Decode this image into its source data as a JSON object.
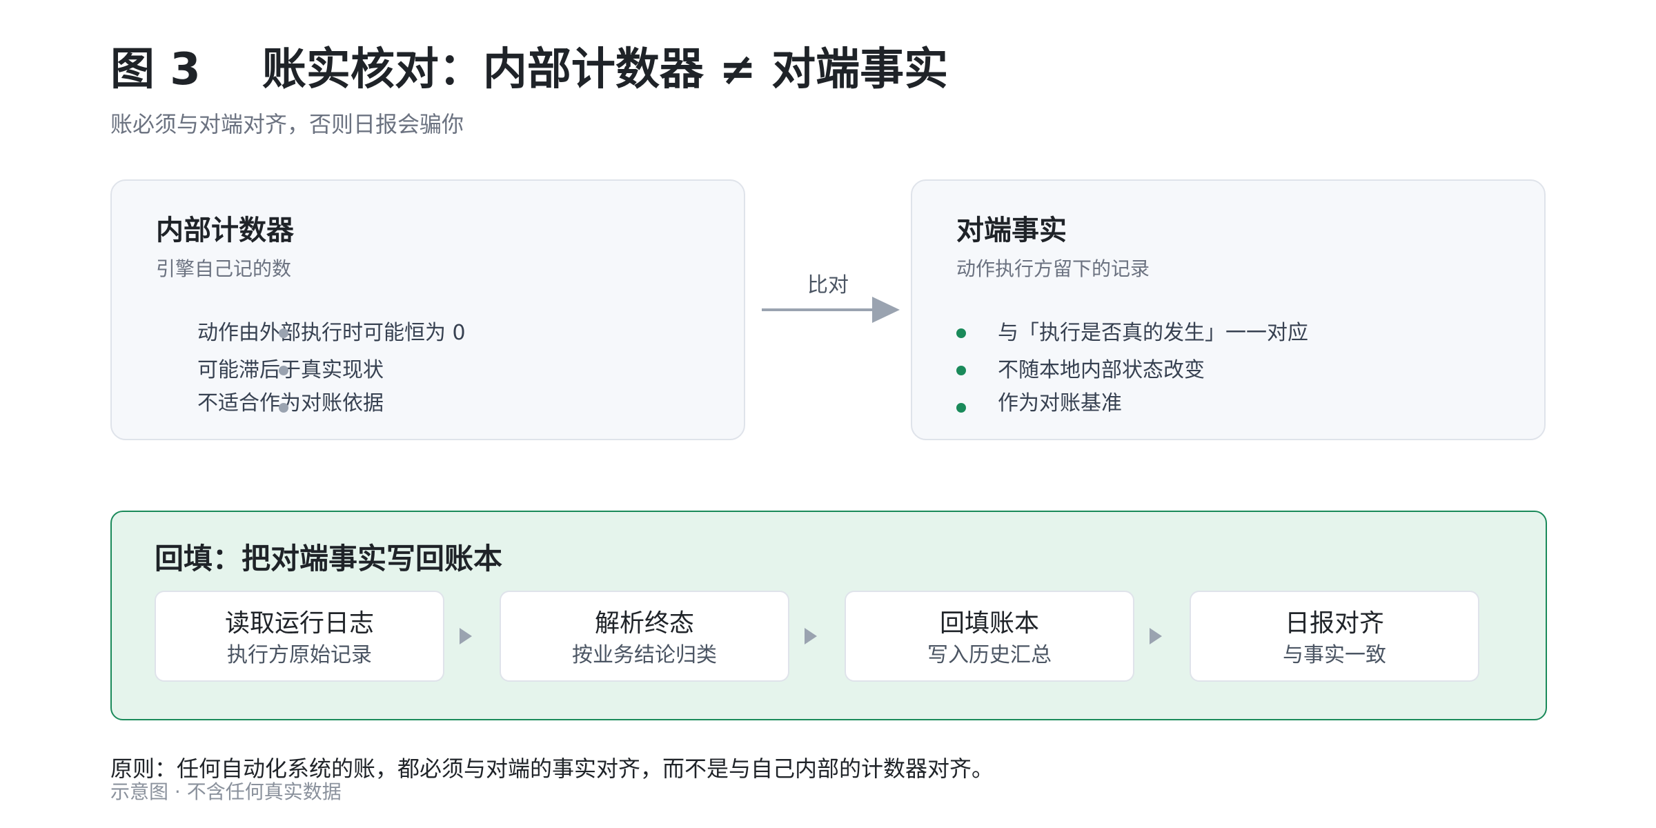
{
  "figure": {
    "title": "图 3    账实核对：内部计数器 ≠ 对端事实",
    "subtitle": "账必须与对端对齐，否则日报会骗你"
  },
  "internal_counter": {
    "title": "内部计数器",
    "subtitle": "引擎自己记的数",
    "bullets": [
      "动作由外部执行时可能恒为 0",
      "可能滞后于真实现状",
      "不适合作为对账依据"
    ],
    "bullet_color": "#9aa3b0"
  },
  "compare": {
    "label": "比对",
    "arrow_color": "#9aa3b0"
  },
  "peer_fact": {
    "title": "对端事实",
    "subtitle": "动作执行方留下的记录",
    "bullets": [
      "与「执行是否真的发生」一一对应",
      "不随本地内部状态改变",
      "作为对账基准"
    ],
    "bullet_color": "#1a8a5a"
  },
  "backfill": {
    "title": "回填：把对端事实写回账本",
    "accent": "#1a8a5a",
    "steps": [
      {
        "title": "读取运行日志",
        "subtitle": "执行方原始记录"
      },
      {
        "title": "解析终态",
        "subtitle": "按业务结论归类"
      },
      {
        "title": "回填账本",
        "subtitle": "写入历史汇总"
      },
      {
        "title": "日报对齐",
        "subtitle": "与事实一致"
      }
    ]
  },
  "principle": "原则：任何自动化系统的账，都必须与对端的事实对齐，而不是与自己内部的计数器对齐。",
  "footnote": "示意图 · 不含任何真实数据"
}
